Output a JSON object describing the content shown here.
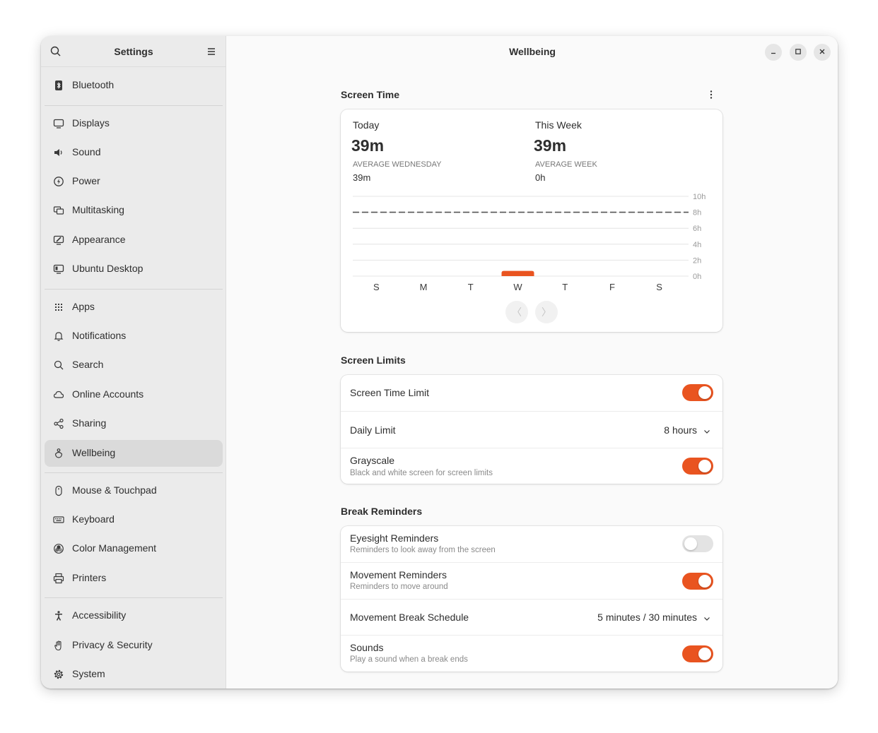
{
  "sidebar": {
    "title": "Settings",
    "search_icon": "search-icon",
    "menu_icon": "hamburger-menu-icon",
    "items": [
      {
        "label": "Bluetooth",
        "icon": "bluetooth-icon"
      },
      {
        "label": "Displays",
        "icon": "display-icon"
      },
      {
        "label": "Sound",
        "icon": "speaker-icon"
      },
      {
        "label": "Power",
        "icon": "power-icon"
      },
      {
        "label": "Multitasking",
        "icon": "multitasking-icon"
      },
      {
        "label": "Appearance",
        "icon": "appearance-icon"
      },
      {
        "label": "Ubuntu Desktop",
        "icon": "desktop-icon"
      },
      {
        "label": "Apps",
        "icon": "apps-grid-icon"
      },
      {
        "label": "Notifications",
        "icon": "bell-icon"
      },
      {
        "label": "Search",
        "icon": "search-icon"
      },
      {
        "label": "Online Accounts",
        "icon": "cloud-icon"
      },
      {
        "label": "Sharing",
        "icon": "share-icon"
      },
      {
        "label": "Wellbeing",
        "icon": "wellbeing-icon",
        "active": true
      },
      {
        "label": "Mouse & Touchpad",
        "icon": "mouse-icon"
      },
      {
        "label": "Keyboard",
        "icon": "keyboard-icon"
      },
      {
        "label": "Color Management",
        "icon": "color-icon"
      },
      {
        "label": "Printers",
        "icon": "printer-icon"
      },
      {
        "label": "Accessibility",
        "icon": "accessibility-icon"
      },
      {
        "label": "Privacy & Security",
        "icon": "hand-icon"
      },
      {
        "label": "System",
        "icon": "gear-icon"
      }
    ]
  },
  "main": {
    "title": "Wellbeing",
    "screen_time": {
      "section_title": "Screen Time",
      "today_label": "Today",
      "today_value": "39m",
      "today_avg_caption": "AVERAGE WEDNESDAY",
      "today_avg_value": "39m",
      "week_label": "This Week",
      "week_value": "39m",
      "week_avg_caption": "AVERAGE WEEK",
      "week_avg_value": "0h",
      "prev_label": "〈",
      "next_label": "〉"
    },
    "screen_limits": {
      "section_title": "Screen Limits",
      "screen_time_limit": {
        "title": "Screen Time Limit",
        "on": true
      },
      "daily_limit": {
        "title": "Daily Limit",
        "value": "8 hours"
      },
      "grayscale": {
        "title": "Grayscale",
        "subtitle": "Black and white screen for screen limits",
        "on": true
      }
    },
    "break_reminders": {
      "section_title": "Break Reminders",
      "eyesight": {
        "title": "Eyesight Reminders",
        "subtitle": "Reminders to look away from the screen",
        "on": false
      },
      "movement": {
        "title": "Movement Reminders",
        "subtitle": "Reminders to move around",
        "on": true
      },
      "schedule": {
        "title": "Movement Break Schedule",
        "value": "5 minutes / 30 minutes"
      },
      "sounds": {
        "title": "Sounds",
        "subtitle": "Play a sound when a break ends",
        "on": true
      }
    }
  },
  "window_controls": {
    "minimize": "minimize-icon",
    "maximize": "maximize-icon",
    "close": "close-icon"
  },
  "colors": {
    "accent": "#e95420"
  },
  "chart_data": {
    "type": "bar",
    "categories": [
      "S",
      "M",
      "T",
      "W",
      "T",
      "F",
      "S"
    ],
    "values": [
      0,
      0,
      0,
      0.65,
      0,
      0,
      0
    ],
    "unit": "hours",
    "y_ticks": [
      "0h",
      "2h",
      "4h",
      "6h",
      "8h",
      "10h"
    ],
    "ylim": [
      0,
      10
    ],
    "limit_line": 8,
    "grid": true,
    "bar_color": "#e95420"
  }
}
